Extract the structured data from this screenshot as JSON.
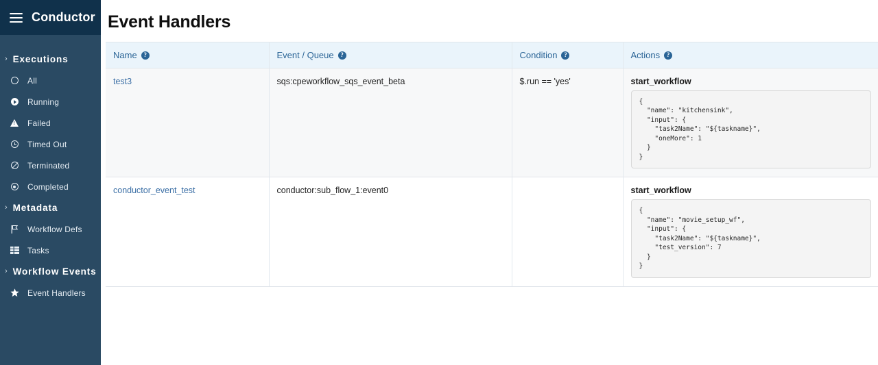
{
  "brand": {
    "name": "Conductor",
    "menu_icon": "hamburger-icon"
  },
  "colors": {
    "sidebar_bg": "#2a4a63",
    "brand_bg": "#10314b",
    "header_bg": "#eaf4fb",
    "link": "#3a6ea5",
    "header_text": "#2a6496",
    "row_alt_bg": "#f7f8f9",
    "code_bg": "#f4f4f4"
  },
  "sidebar": {
    "sections": [
      {
        "label": "Executions",
        "chevron": "chevron-right-icon",
        "items": [
          {
            "label": "All",
            "icon": "circle-outline-icon"
          },
          {
            "label": "Running",
            "icon": "play-circle-icon"
          },
          {
            "label": "Failed",
            "icon": "warning-triangle-icon"
          },
          {
            "label": "Timed Out",
            "icon": "clock-icon"
          },
          {
            "label": "Terminated",
            "icon": "ban-circle-icon"
          },
          {
            "label": "Completed",
            "icon": "target-circle-icon"
          }
        ]
      },
      {
        "label": "Metadata",
        "chevron": "chevron-right-icon",
        "items": [
          {
            "label": "Workflow Defs",
            "icon": "flag-icon"
          },
          {
            "label": "Tasks",
            "icon": "list-stack-icon"
          }
        ]
      },
      {
        "label": "Workflow Events",
        "chevron": "chevron-right-icon",
        "items": [
          {
            "label": "Event Handlers",
            "icon": "star-icon"
          }
        ]
      }
    ]
  },
  "page": {
    "title": "Event Handlers"
  },
  "table": {
    "columns": [
      {
        "label": "Name",
        "help_icon": "help-circle-icon"
      },
      {
        "label": "Event / Queue",
        "help_icon": "help-circle-icon"
      },
      {
        "label": "Condition",
        "help_icon": "help-circle-icon"
      },
      {
        "label": "Actions",
        "help_icon": "help-circle-icon"
      }
    ],
    "rows": [
      {
        "name": "test3",
        "event_queue": "sqs:cpeworkflow_sqs_event_beta",
        "condition": "$.run == 'yes'",
        "action_title": "start_workflow",
        "action_json": "{\n  \"name\": \"kitchensink\",\n  \"input\": {\n    \"task2Name\": \"${taskname}\",\n    \"oneMore\": 1\n  }\n}"
      },
      {
        "name": "conductor_event_test",
        "event_queue": "conductor:sub_flow_1:event0",
        "condition": "",
        "action_title": "start_workflow",
        "action_json": "{\n  \"name\": \"movie_setup_wf\",\n  \"input\": {\n    \"task2Name\": \"${taskname}\",\n    \"test_version\": 7\n  }\n}"
      }
    ]
  }
}
